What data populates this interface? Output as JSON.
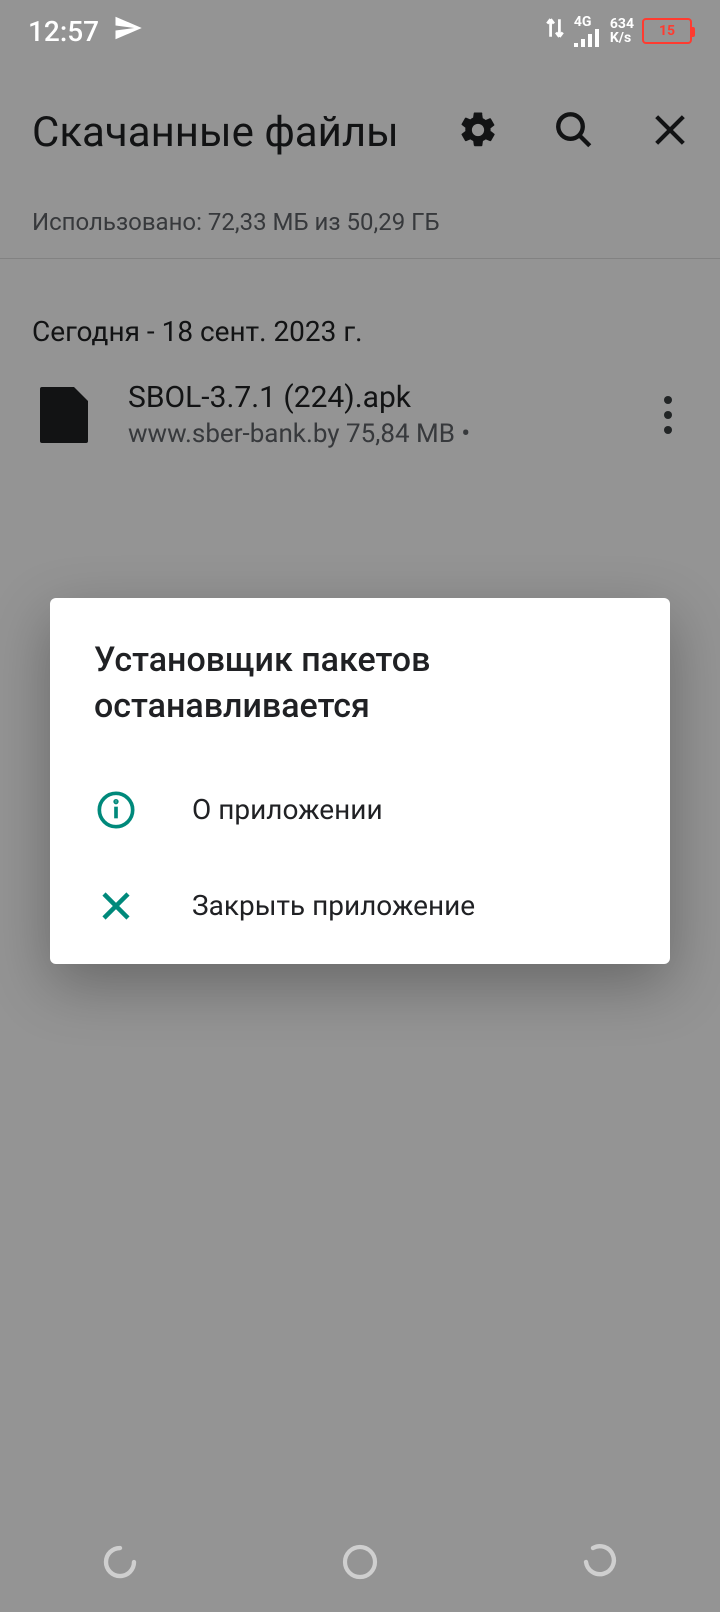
{
  "status": {
    "time": "12:57",
    "network_type": "4G",
    "net_speed_top": "634",
    "net_speed_unit": "K/s",
    "battery_pct": "15"
  },
  "header": {
    "title": "Скачанные файлы"
  },
  "storage_line": "Использовано: 72,33 МБ из 50,29 ГБ",
  "section_label": "Сегодня - 18 сент. 2023 г.",
  "file": {
    "name": "SBOL-3.7.1 (224).apk",
    "meta": "www.sber-bank.by 75,84 MB •"
  },
  "dialog": {
    "title": "Установщик пакетов останавливается",
    "about_label": "О приложении",
    "close_label": "Закрыть приложение"
  },
  "colors": {
    "accent": "#00897b",
    "battery_red": "#ff3b30"
  }
}
